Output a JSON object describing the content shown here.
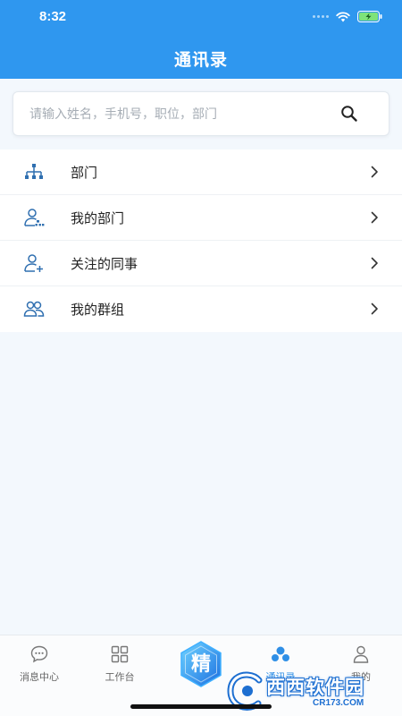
{
  "status_bar": {
    "time": "8:32"
  },
  "header": {
    "title": "通讯录"
  },
  "search": {
    "placeholder": "请输入姓名，手机号，职位，部门",
    "value": ""
  },
  "menu": {
    "items": [
      {
        "label": "部门",
        "icon": "org-chart-icon"
      },
      {
        "label": "我的部门",
        "icon": "user-group-icon"
      },
      {
        "label": "关注的同事",
        "icon": "user-add-icon"
      },
      {
        "label": "我的群组",
        "icon": "users-icon"
      }
    ]
  },
  "tabbar": {
    "tabs": [
      {
        "label": "消息中心",
        "icon": "chat-icon"
      },
      {
        "label": "工作台",
        "icon": "grid-icon"
      },
      {
        "label": "通讯录",
        "icon": "contacts-icon",
        "active": true
      },
      {
        "label": "我的",
        "icon": "profile-icon"
      }
    ],
    "center_badge": {
      "label": "精"
    }
  },
  "watermark": {
    "text": "西西软件园",
    "sub": "CR173.COM"
  },
  "colors": {
    "primary": "#2f97ef",
    "active_tab": "#2f8fe6",
    "icon_blue": "#2f6fb0"
  }
}
